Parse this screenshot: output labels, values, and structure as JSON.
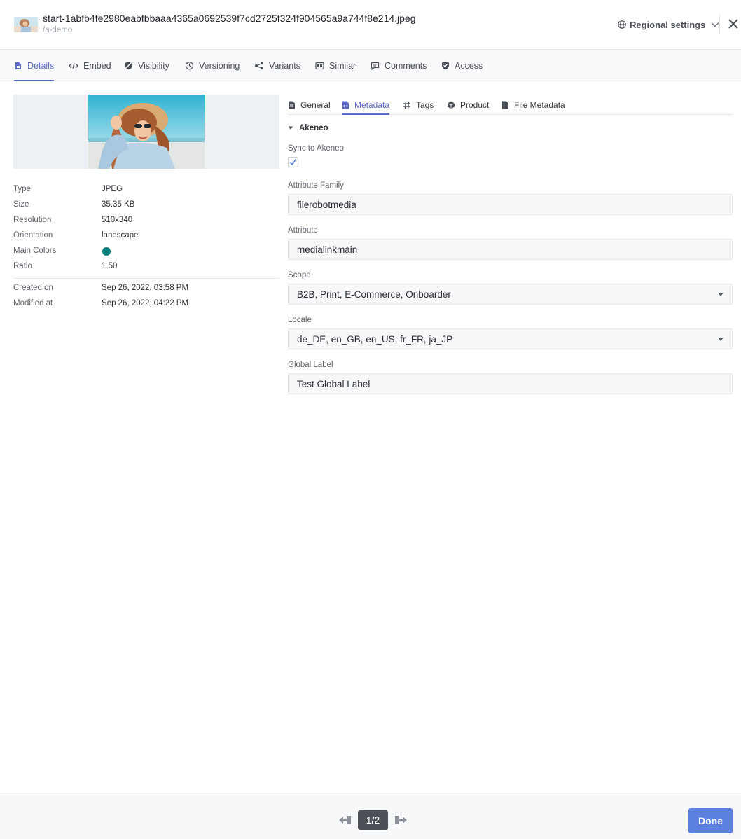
{
  "header": {
    "filename": "start-1abfb4fe2980eabfbbaaa4365a0692539f7cd2725f324f904565a9a744f8e214.jpeg",
    "folder": "/a-demo",
    "regional_settings": "Regional settings"
  },
  "main_tabs": [
    {
      "label": "Details",
      "icon": "details-icon",
      "active": true
    },
    {
      "label": "Embed",
      "icon": "code-icon"
    },
    {
      "label": "Visibility",
      "icon": "visibility-icon"
    },
    {
      "label": "Versioning",
      "icon": "history-icon"
    },
    {
      "label": "Variants",
      "icon": "variants-icon"
    },
    {
      "label": "Similar",
      "icon": "similar-icon"
    },
    {
      "label": "Comments",
      "icon": "comment-icon"
    },
    {
      "label": "Access",
      "icon": "shield-icon"
    }
  ],
  "info": {
    "type": {
      "label": "Type",
      "value": "JPEG"
    },
    "size": {
      "label": "Size",
      "value": "35.35 KB"
    },
    "resolution": {
      "label": "Resolution",
      "value": "510x340"
    },
    "orientation": {
      "label": "Orientation",
      "value": "landscape"
    },
    "main_colors": {
      "label": "Main Colors",
      "color": "#007f7a"
    },
    "ratio": {
      "label": "Ratio",
      "value": "1.50"
    },
    "created": {
      "label": "Created on",
      "value": "Sep 26, 2022, 03:58 PM"
    },
    "modified": {
      "label": "Modified at",
      "value": "Sep 26, 2022, 04:22 PM"
    }
  },
  "sub_tabs": [
    {
      "label": "General",
      "icon": "document-icon"
    },
    {
      "label": "Metadata",
      "icon": "metadata-icon",
      "active": true
    },
    {
      "label": "Tags",
      "icon": "hash-icon"
    },
    {
      "label": "Product",
      "icon": "product-icon"
    },
    {
      "label": "File Metadata",
      "icon": "file-icon"
    }
  ],
  "akeneo": {
    "title": "Akeneo",
    "sync_label": "Sync to Akeneo",
    "sync_checked": true,
    "attribute_family": {
      "label": "Attribute Family",
      "value": "filerobotmedia"
    },
    "attribute": {
      "label": "Attribute",
      "value": "medialinkmain"
    },
    "scope": {
      "label": "Scope",
      "value": "B2B, Print, E-Commerce, Onboarder"
    },
    "locale": {
      "label": "Locale",
      "value": "de_DE, en_GB, en_US, fr_FR, ja_JP"
    },
    "global_label": {
      "label": "Global Label",
      "value": "Test Global Label"
    }
  },
  "footer": {
    "pager": "1/2",
    "done": "Done"
  },
  "colors": {
    "accent": "#5c6bc0",
    "done_button": "#5b80e0",
    "main_color_swatch": "#007f7a"
  }
}
